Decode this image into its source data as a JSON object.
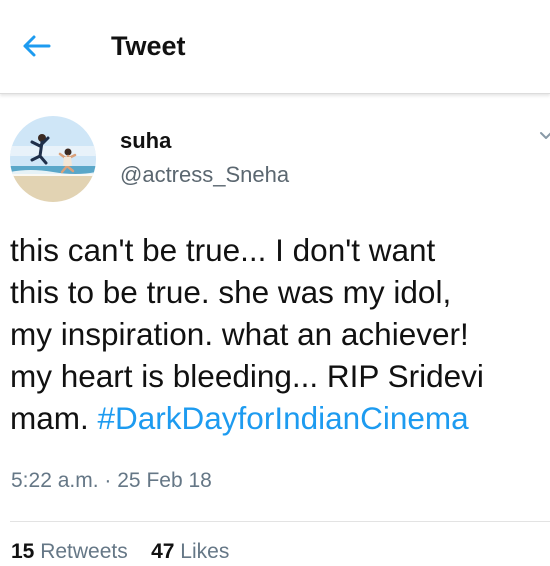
{
  "header": {
    "title": "Tweet"
  },
  "author": {
    "name": "suha",
    "handle": "@actress_Sneha"
  },
  "tweet": {
    "text": "this can't be true... I don't want\nthis to be true. she was my idol,\nmy inspiration. what an achiever!\nmy heart is bleeding... RIP Sridevi\nmam. ",
    "hashtag": "#DarkDayforIndianCinema",
    "time": "5:22 a.m.",
    "separator": "·",
    "date": "25 Feb 18"
  },
  "stats": {
    "retweets_count": "15",
    "retweets_label": "Retweets",
    "likes_count": "47",
    "likes_label": "Likes"
  },
  "colors": {
    "accent": "#1d9bf0",
    "text": "#111111",
    "secondary": "#657786"
  },
  "icons": {
    "back": "arrow-left-icon",
    "more": "chevron-down-icon"
  }
}
